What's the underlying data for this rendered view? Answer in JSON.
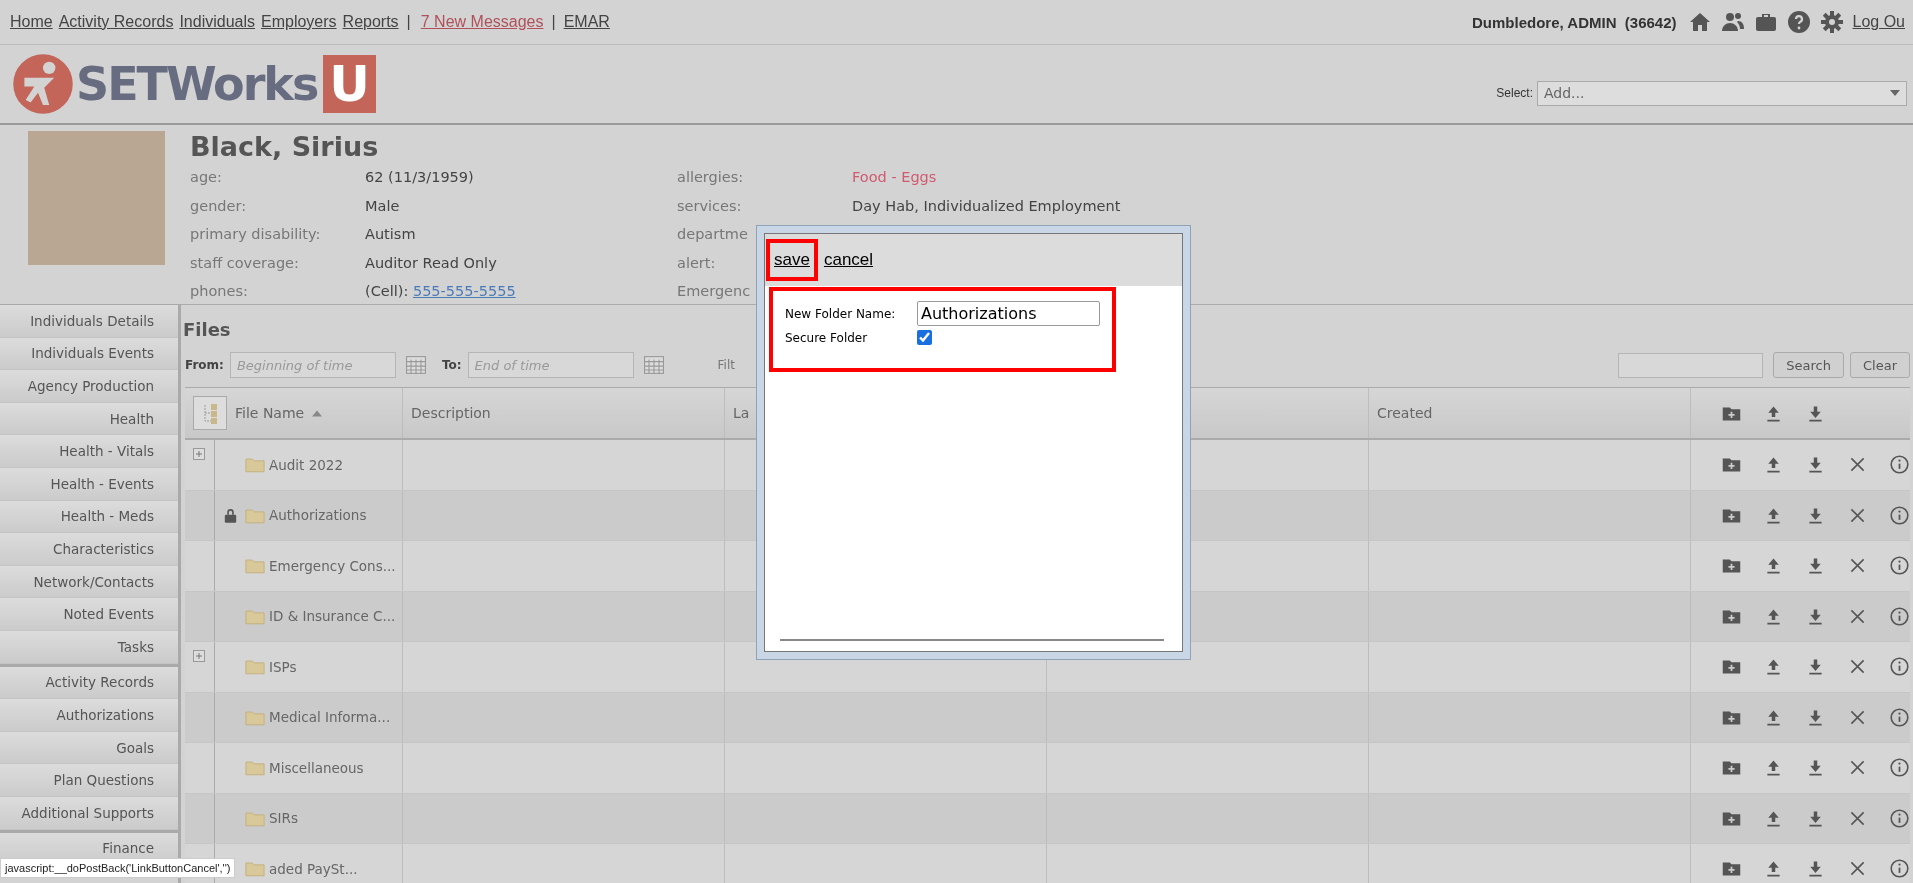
{
  "top_nav": {
    "links": [
      {
        "label": "Home",
        "kind": "link"
      },
      {
        "label": "Activity Records",
        "kind": "link"
      },
      {
        "label": "Individuals",
        "kind": "link"
      },
      {
        "label": "Employers",
        "kind": "link"
      },
      {
        "label": "Reports",
        "kind": "link"
      },
      {
        "label": "|",
        "kind": "separator"
      },
      {
        "label": "7 New Messages",
        "kind": "alert"
      },
      {
        "label": "|",
        "kind": "separator"
      },
      {
        "label": "EMAR",
        "kind": "link"
      }
    ],
    "user": "Dumbledore, ADMIN  (36642)",
    "logout": "Log Ou"
  },
  "logo": {
    "text": "SETWorks",
    "letter": "U"
  },
  "select": {
    "label": "Select:",
    "value": "Add..."
  },
  "profile": {
    "name": "Black, Sirius",
    "left_fields": [
      {
        "label": "age:",
        "value": "62 (11/3/1959)",
        "kind": "text"
      },
      {
        "label": "gender:",
        "value": "Male",
        "kind": "text"
      },
      {
        "label": "primary disability:",
        "value": "Autism",
        "kind": "text"
      },
      {
        "label": "staff coverage:",
        "value": "Auditor Read Only",
        "kind": "text"
      },
      {
        "label": "phones:",
        "value": "(Cell):",
        "link": "555-555-5555",
        "kind": "phone"
      }
    ],
    "right_fields": [
      {
        "label": "allergies:",
        "value": "Food - Eggs",
        "kind": "alert"
      },
      {
        "label": "services:",
        "value": "Day Hab, Individualized Employment",
        "kind": "text"
      },
      {
        "label": "departme",
        "kind": "label_only"
      },
      {
        "label": "alert:",
        "kind": "label_only"
      },
      {
        "label": "Emergenc",
        "kind": "label_only"
      }
    ]
  },
  "sidebar": {
    "groups": [
      [
        "Individuals Details",
        "Individuals Events",
        "Agency Production",
        "Health",
        "Health - Vitals",
        "Health - Events",
        "Health - Meds",
        "Characteristics",
        "Network/Contacts",
        "Noted Events",
        "Tasks"
      ],
      [
        "Activity Records",
        "Authorizations",
        "Goals",
        "Plan Questions",
        "Additional Supports"
      ],
      [
        "Finance"
      ]
    ]
  },
  "files": {
    "title": "Files",
    "from": {
      "label": "From:",
      "placeholder": "Beginning of time"
    },
    "to": {
      "label": "To:",
      "placeholder": "End of time"
    },
    "filter_label": "Filt",
    "search_button": "Search",
    "clear_button": "Clear",
    "columns": [
      "File Name",
      "Description",
      "La",
      "",
      "Created"
    ],
    "rows": [
      {
        "name": "Audit 2022",
        "locked": false,
        "expandable": true
      },
      {
        "name": "Authorizations",
        "locked": true,
        "expandable": false
      },
      {
        "name": "Emergency Cons...",
        "locked": false,
        "expandable": false
      },
      {
        "name": "ID & Insurance C...",
        "locked": false,
        "expandable": false
      },
      {
        "name": "ISPs",
        "locked": false,
        "expandable": true
      },
      {
        "name": "Medical Informa...",
        "locked": false,
        "expandable": false
      },
      {
        "name": "Miscellaneous",
        "locked": false,
        "expandable": false
      },
      {
        "name": "SIRs",
        "locked": false,
        "expandable": false
      },
      {
        "name": "aded PaySt...",
        "locked": false,
        "expandable": false
      }
    ]
  },
  "dialog": {
    "save": "save",
    "cancel": "cancel",
    "name_label": "New Folder Name:",
    "name_value": "Authorizations",
    "secure_label": "Secure Folder",
    "secure_checked": true
  },
  "status_tooltip": "javascript:__doPostBack('LinkButtonCancel','')"
}
